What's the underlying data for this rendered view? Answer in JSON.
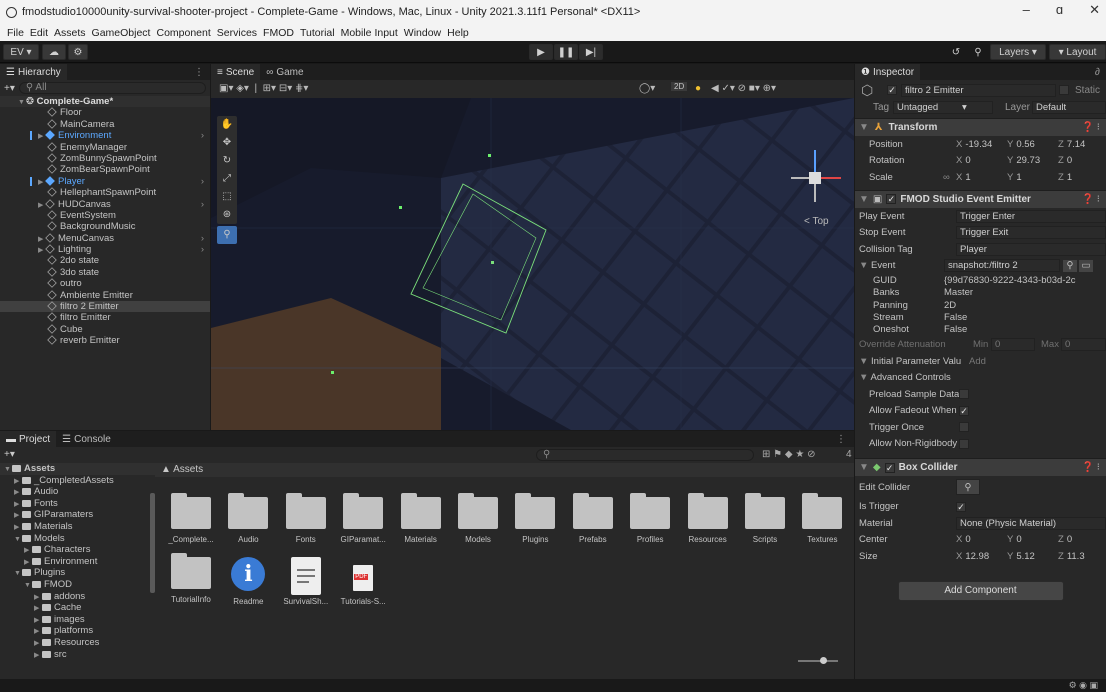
{
  "window": {
    "title": "fmodstudio10000unity-survival-shooter-project - Complete-Game - Windows, Mac, Linux - Unity 2021.3.11f1 Personal* <DX11>",
    "controls": [
      "–",
      "ɑ",
      "✕"
    ]
  },
  "menu": [
    "File",
    "Edit",
    "Assets",
    "GameObject",
    "Component",
    "Services",
    "FMOD",
    "Tutorial",
    "Mobile Input",
    "Window",
    "Help"
  ],
  "toolbar": {
    "account": "EV ▾",
    "layers": "Layers",
    "layout": "Layout"
  },
  "hierarchy": {
    "tab": "Hierarchy",
    "search": "All",
    "scene": "Complete-Game*",
    "items": [
      {
        "label": "Floor",
        "indent": 2,
        "style": "normal"
      },
      {
        "label": "MainCamera",
        "indent": 2,
        "style": "normal"
      },
      {
        "label": "Environment",
        "indent": 1,
        "style": "prefab",
        "expandable": true
      },
      {
        "label": "EnemyManager",
        "indent": 2,
        "style": "normal"
      },
      {
        "label": "ZomBunnySpawnPoint",
        "indent": 2,
        "style": "normal"
      },
      {
        "label": "ZomBearSpawnPoint",
        "indent": 2,
        "style": "normal"
      },
      {
        "label": "Player",
        "indent": 1,
        "style": "prefab",
        "expandable": true
      },
      {
        "label": "HellephantSpawnPoint",
        "indent": 2,
        "style": "normal"
      },
      {
        "label": "HUDCanvas",
        "indent": 1,
        "style": "normal",
        "expandable": true
      },
      {
        "label": "EventSystem",
        "indent": 2,
        "style": "normal"
      },
      {
        "label": "BackgroundMusic",
        "indent": 2,
        "style": "normal"
      },
      {
        "label": "MenuCanvas",
        "indent": 1,
        "style": "normal",
        "expandable": true
      },
      {
        "label": "Lighting",
        "indent": 1,
        "style": "normal",
        "expandable": true
      },
      {
        "label": "2do state",
        "indent": 2,
        "style": "normal"
      },
      {
        "label": "3do state",
        "indent": 2,
        "style": "normal"
      },
      {
        "label": "outro",
        "indent": 2,
        "style": "normal"
      },
      {
        "label": "Ambiente Emitter",
        "indent": 2,
        "style": "normal"
      },
      {
        "label": "filtro 2 Emitter",
        "indent": 2,
        "style": "selected"
      },
      {
        "label": "filtro Emitter",
        "indent": 2,
        "style": "normal"
      },
      {
        "label": "Cube",
        "indent": 2,
        "style": "normal"
      },
      {
        "label": "reverb Emitter",
        "indent": 2,
        "style": "normal"
      }
    ]
  },
  "scene": {
    "tabs": [
      "Scene",
      "Game"
    ],
    "view_mode": "2D",
    "gizmo_label": "< Top"
  },
  "project": {
    "tabs": [
      "Project",
      "Console"
    ],
    "count_badge": "4",
    "tree": [
      {
        "label": "Assets",
        "indent": 0,
        "expanded": true
      },
      {
        "label": "_CompletedAssets",
        "indent": 1
      },
      {
        "label": "Audio",
        "indent": 1
      },
      {
        "label": "Fonts",
        "indent": 1
      },
      {
        "label": "GIParamaters",
        "indent": 1
      },
      {
        "label": "Materials",
        "indent": 1
      },
      {
        "label": "Models",
        "indent": 1,
        "expanded": true
      },
      {
        "label": "Characters",
        "indent": 2
      },
      {
        "label": "Environment",
        "indent": 2
      },
      {
        "label": "Plugins",
        "indent": 1,
        "expanded": true
      },
      {
        "label": "FMOD",
        "indent": 2,
        "expanded": true
      },
      {
        "label": "addons",
        "indent": 3
      },
      {
        "label": "Cache",
        "indent": 3
      },
      {
        "label": "images",
        "indent": 3
      },
      {
        "label": "platforms",
        "indent": 3
      },
      {
        "label": "Resources",
        "indent": 3
      },
      {
        "label": "src",
        "indent": 3
      }
    ],
    "breadcrumb": "Assets",
    "assets_row1": [
      "_Complete...",
      "Audio",
      "Fonts",
      "GIParamat...",
      "Materials",
      "Models",
      "Plugins",
      "Prefabs",
      "Profiles",
      "Resources",
      "Scripts",
      "Textures"
    ],
    "assets_row2": [
      {
        "label": "TutorialInfo",
        "kind": "folder"
      },
      {
        "label": "Readme",
        "kind": "info"
      },
      {
        "label": "SurvivalSh...",
        "kind": "doc"
      },
      {
        "label": "Tutorials-S...",
        "kind": "pdf"
      }
    ],
    "pdf_tag": "PDF"
  },
  "inspector": {
    "tab": "Inspector",
    "object_name": "filtro 2 Emitter",
    "static_label": "Static",
    "tag_label": "Tag",
    "tag_value": "Untagged",
    "layer_label": "Layer",
    "layer_value": "Default",
    "transform": {
      "title": "Transform",
      "rows": [
        {
          "label": "Position",
          "x": "-19.34",
          "y": "0.56",
          "z": "7.14"
        },
        {
          "label": "Rotation",
          "x": "0",
          "y": "29.73",
          "z": "0"
        },
        {
          "label": "Scale",
          "x": "1",
          "y": "1",
          "z": "1"
        }
      ]
    },
    "emitter": {
      "title": "FMOD Studio Event Emitter",
      "play_event_label": "Play Event",
      "play_event": "Trigger Enter",
      "stop_event_label": "Stop Event",
      "stop_event": "Trigger Exit",
      "collision_tag_label": "Collision Tag",
      "collision_tag": "Player",
      "event_label": "Event",
      "event_value": "snapshot:/filtro 2",
      "details": [
        {
          "label": "GUID",
          "value": "{99d76830-9222-4343-b03d-2c"
        },
        {
          "label": "Banks",
          "value": "Master"
        },
        {
          "label": "Panning",
          "value": "2D"
        },
        {
          "label": "Stream",
          "value": "False"
        },
        {
          "label": "Oneshot",
          "value": "False"
        }
      ],
      "override_label": "Override Attenuation",
      "min_label": "Min",
      "min_value": "0",
      "max_label": "Max",
      "max_value": "0",
      "initial_param_label": "Initial Parameter Valu",
      "add_label": "Add",
      "advanced_label": "Advanced Controls",
      "checks": [
        {
          "label": "Preload Sample Data",
          "checked": false
        },
        {
          "label": "Allow Fadeout When",
          "checked": true
        },
        {
          "label": "Trigger Once",
          "checked": false
        },
        {
          "label": "Allow Non-Rigidbody",
          "checked": false
        }
      ]
    },
    "box_collider": {
      "title": "Box Collider",
      "edit_collider_label": "Edit Collider",
      "is_trigger_label": "Is Trigger",
      "material_label": "Material",
      "material_value": "None (Physic Material)",
      "center_label": "Center",
      "center": {
        "x": "0",
        "y": "0",
        "z": "0"
      },
      "size_label": "Size",
      "size": {
        "x": "12.98",
        "y": "5.12",
        "z": "11.3"
      }
    },
    "add_component": "Add Component"
  },
  "colors": {
    "accent_blue": "#5ca8ff",
    "panel": "#282828",
    "selected": "#404040"
  }
}
